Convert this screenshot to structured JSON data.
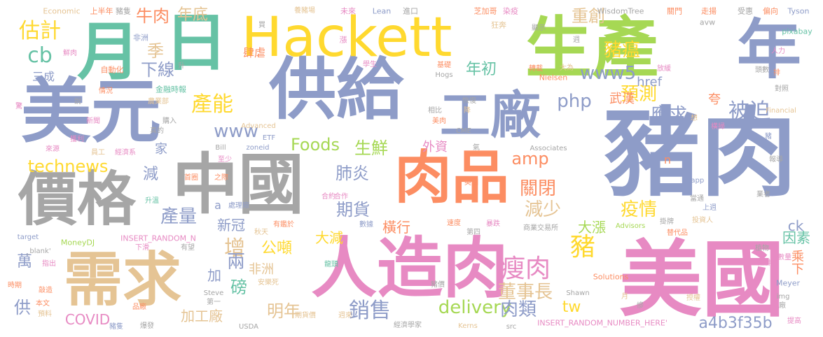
{
  "palette": {
    "slate": "#8E9CC8",
    "grey": "#A6A6A6",
    "green": "#66C2A5",
    "orange": "#FC8D62",
    "pink": "#E78AC3",
    "lime": "#A6D854",
    "yellow": "#FFD92F",
    "tan": "#E5C494"
  },
  "words": [
    {
      "id": "zhu-rou",
      "text": "豬肉",
      "color": "slate"
    },
    {
      "id": "mei-guo",
      "text": "美國",
      "color": "pink"
    },
    {
      "id": "sheng-chan",
      "text": "生產",
      "color": "lime"
    },
    {
      "id": "gong-ji",
      "text": "供給",
      "color": "slate"
    },
    {
      "id": "mei-yuan",
      "text": "美元",
      "color": "slate"
    },
    {
      "id": "hackett",
      "text": "Hackett",
      "color": "yellow"
    },
    {
      "id": "zhong-guo",
      "text": "中國",
      "color": "grey"
    },
    {
      "id": "ren-zao-rou",
      "text": "人造肉",
      "color": "pink"
    },
    {
      "id": "xu-qiu",
      "text": "需求",
      "color": "tan"
    },
    {
      "id": "rou-pin",
      "text": "肉品",
      "color": "orange"
    },
    {
      "id": "jia-ge",
      "text": "價格",
      "color": "grey"
    },
    {
      "id": "gong-chang",
      "text": "工廠",
      "color": "slate"
    },
    {
      "id": "nian",
      "text": "年",
      "color": "slate"
    },
    {
      "id": "yue",
      "text": "月",
      "color": "green"
    },
    {
      "id": "ri",
      "text": "日",
      "color": "green"
    },
    {
      "id": "shou-rou",
      "text": "瘦肉",
      "color": "pink"
    },
    {
      "id": "zhu",
      "text": "豬",
      "color": "yellow"
    },
    {
      "id": "foods",
      "text": "Foods",
      "color": "lime"
    },
    {
      "id": "chan-neng",
      "text": "產能",
      "color": "yellow"
    },
    {
      "id": "www5",
      "text": "www5",
      "color": "slate"
    },
    {
      "id": "www",
      "text": "www",
      "color": "slate"
    },
    {
      "id": "technews",
      "text": "technews",
      "color": "yellow"
    },
    {
      "id": "delivery",
      "text": "delivery",
      "color": "lime"
    },
    {
      "id": "php",
      "text": "php",
      "color": "slate"
    },
    {
      "id": "xiao-shou",
      "text": "銷售",
      "color": "slate"
    },
    {
      "id": "dong-shi-zhang",
      "text": "董事長",
      "color": "tan"
    },
    {
      "id": "rou-lei",
      "text": "肉類",
      "color": "slate"
    },
    {
      "id": "qi-huo",
      "text": "期貨",
      "color": "slate"
    },
    {
      "id": "jian-shao",
      "text": "減少",
      "color": "tan"
    },
    {
      "id": "guan-bi",
      "text": "關閉",
      "color": "orange"
    },
    {
      "id": "yi-qing",
      "text": "疫情",
      "color": "yellow"
    },
    {
      "id": "yu-ce",
      "text": "預測",
      "color": "yellow"
    },
    {
      "id": "ying-qiu",
      "text": "應求",
      "color": "slate"
    },
    {
      "id": "bei-po",
      "text": "被迫",
      "color": "slate"
    },
    {
      "id": "zhu-wen",
      "text": "豬瘟",
      "color": "yellow"
    },
    {
      "id": "zhong-chuang",
      "text": "重創",
      "color": "tan"
    },
    {
      "id": "nian-di",
      "text": "年底",
      "color": "tan"
    },
    {
      "id": "niu-rou",
      "text": "牛肉",
      "color": "orange"
    },
    {
      "id": "gu-ji",
      "text": "估計",
      "color": "yellow"
    },
    {
      "id": "cb",
      "text": "cb",
      "color": "green"
    },
    {
      "id": "ji",
      "text": "季",
      "color": "tan"
    },
    {
      "id": "xia-xian",
      "text": "下線",
      "color": "slate"
    },
    {
      "id": "nian-chu",
      "text": "年初",
      "color": "green"
    },
    {
      "id": "sheng-xian",
      "text": "生鮮",
      "color": "lime"
    },
    {
      "id": "fei-yan",
      "text": "肺炎",
      "color": "slate"
    },
    {
      "id": "amp",
      "text": "amp",
      "color": "orange"
    },
    {
      "id": "chan-liang",
      "text": "產量",
      "color": "slate"
    },
    {
      "id": "xin-guan",
      "text": "新冠",
      "color": "slate"
    },
    {
      "id": "zeng",
      "text": "增",
      "color": "tan"
    },
    {
      "id": "gong-dun",
      "text": "公噸",
      "color": "yellow"
    },
    {
      "id": "da-jian",
      "text": "大減",
      "color": "yellow"
    },
    {
      "id": "heng-xing",
      "text": "橫行",
      "color": "orange"
    },
    {
      "id": "da-zhang",
      "text": "大漲",
      "color": "lime"
    },
    {
      "id": "a4b3f35b",
      "text": "a4b3f35b",
      "color": "slate"
    },
    {
      "id": "yin-su",
      "text": "因素",
      "color": "green"
    },
    {
      "id": "ming-nian",
      "text": "明年",
      "color": "tan"
    },
    {
      "id": "jia-gong-chang",
      "text": "加工廠",
      "color": "tan"
    },
    {
      "id": "covid",
      "text": "COVID",
      "color": "pink"
    },
    {
      "id": "tw",
      "text": "tw",
      "color": "yellow"
    },
    {
      "id": "ck",
      "text": "ck",
      "color": "slate"
    },
    {
      "id": "gong",
      "text": "供",
      "color": "slate"
    },
    {
      "id": "bang",
      "text": "磅",
      "color": "green"
    },
    {
      "id": "liang",
      "text": "兩",
      "color": "slate"
    },
    {
      "id": "jia",
      "text": "加",
      "color": "slate"
    },
    {
      "id": "fei-zhou",
      "text": "非洲",
      "color": "tan"
    },
    {
      "id": "wan",
      "text": "萬",
      "color": "slate"
    },
    {
      "id": "jian",
      "text": "減",
      "color": "slate"
    },
    {
      "id": "jia-home",
      "text": "家",
      "color": "slate"
    },
    {
      "id": "wu-han",
      "text": "武漢",
      "color": "orange"
    },
    {
      "id": "href",
      "text": "href",
      "color": "slate"
    },
    {
      "id": "si-nue",
      "text": "肆虐",
      "color": "orange"
    },
    {
      "id": "wai-zi",
      "text": "外資",
      "color": "pink"
    },
    {
      "id": "kua",
      "text": "夸",
      "color": "orange"
    },
    {
      "id": "cheng-xia",
      "text": "乘下",
      "color": "orange"
    },
    {
      "id": "san-cheng",
      "text": "三成",
      "color": "slate"
    },
    {
      "id": "n",
      "text": "n",
      "color": "orange"
    },
    {
      "id": "a",
      "text": "a",
      "color": "slate"
    },
    {
      "id": "insert-random",
      "text": "INSERT_RANDOM_NUMBER_HERE'",
      "color": "pink"
    },
    {
      "id": "insert-random-n",
      "text": "INSERT_RANDOM_N",
      "color": "pink"
    },
    {
      "id": "economic",
      "text": "Economic",
      "color": "tan"
    },
    {
      "id": "shang-ban-nian",
      "text": "上半年",
      "color": "orange"
    },
    {
      "id": "zhu-jian",
      "text": "豬隻",
      "color": "grey"
    },
    {
      "id": "yang-zhu-chang",
      "text": "養豬場",
      "color": "tan"
    },
    {
      "id": "wei-lai",
      "text": "未來",
      "color": "pink"
    },
    {
      "id": "lean",
      "text": "Lean",
      "color": "slate"
    },
    {
      "id": "jin-kou",
      "text": "進口",
      "color": "grey"
    },
    {
      "id": "zhi-jia-ge",
      "text": "芝加哥",
      "color": "orange"
    },
    {
      "id": "ran-yi",
      "text": "染疫",
      "color": "pink"
    },
    {
      "id": "wisdomtree",
      "text": "WisdomTree",
      "color": "grey"
    },
    {
      "id": "guan-men",
      "text": "關門",
      "color": "orange"
    },
    {
      "id": "zou-yang",
      "text": "走揚",
      "color": "orange"
    },
    {
      "id": "shou-hui",
      "text": "受惠",
      "color": "grey"
    },
    {
      "id": "pian-xiang",
      "text": "偏向",
      "color": "orange"
    },
    {
      "id": "tyson",
      "text": "Tyson",
      "color": "slate"
    },
    {
      "id": "fei-zhou-2",
      "text": "非洲",
      "color": "slate"
    },
    {
      "id": "mai",
      "text": "買",
      "color": "grey"
    },
    {
      "id": "zhang",
      "text": "漲",
      "color": "pink"
    },
    {
      "id": "kuang-ben",
      "text": "狂奔",
      "color": "tan"
    },
    {
      "id": "xian-shi",
      "text": "顯示",
      "color": "grey"
    },
    {
      "id": "avw",
      "text": "avw",
      "color": "grey"
    },
    {
      "id": "pixabay",
      "text": "pixabay",
      "color": "green"
    },
    {
      "id": "xian-rou",
      "text": "鮮肉",
      "color": "pink"
    },
    {
      "id": "sheng",
      "text": "升",
      "color": "grey"
    },
    {
      "id": "xue-sheng",
      "text": "學生",
      "color": "pink"
    },
    {
      "id": "zhou",
      "text": "週",
      "color": "grey"
    },
    {
      "id": "ren-li",
      "text": "人力",
      "color": "pink"
    },
    {
      "id": "zi-dong-hua",
      "text": "自動化",
      "color": "orange"
    },
    {
      "id": "ji-chu",
      "text": "基礎",
      "color": "orange"
    },
    {
      "id": "zhuan-zai",
      "text": "轉載",
      "color": "orange"
    },
    {
      "id": "da-wei",
      "text": "大為",
      "color": "tan"
    },
    {
      "id": "fang-huan",
      "text": "放緩",
      "color": "pink"
    },
    {
      "id": "pai",
      "text": "排",
      "color": "orange"
    },
    {
      "id": "jin-rong-shi-bao",
      "text": "金融時報",
      "color": "green"
    },
    {
      "id": "hogs",
      "text": "Hogs",
      "color": "grey"
    },
    {
      "id": "nielsen",
      "text": "Nielsen",
      "color": "orange"
    },
    {
      "id": "pin-shu",
      "text": "頭數",
      "color": "grey"
    },
    {
      "id": "dui-zhao",
      "text": "對照",
      "color": "grey"
    },
    {
      "id": "shuo",
      "text": "說",
      "color": "grey"
    },
    {
      "id": "qing-kuang",
      "text": "情況",
      "color": "orange"
    },
    {
      "id": "nong-ye-bu",
      "text": "農業部",
      "color": "tan"
    },
    {
      "id": "hui-fu",
      "text": "恢復",
      "color": "grey"
    },
    {
      "id": "jing",
      "text": "驚",
      "color": "pink"
    },
    {
      "id": "xiang-bi",
      "text": "相比",
      "color": "grey"
    },
    {
      "id": "jiang",
      "text": "降",
      "color": "tan"
    },
    {
      "id": "financial",
      "text": "Financial",
      "color": "tan"
    },
    {
      "id": "xin-wen",
      "text": "新聞",
      "color": "pink"
    },
    {
      "id": "gou-ru",
      "text": "購入",
      "color": "grey"
    },
    {
      "id": "zhen-de",
      "text": "真的",
      "color": "grey"
    },
    {
      "id": "advanced",
      "text": "Advanced",
      "color": "tan"
    },
    {
      "id": "mei-rou",
      "text": "美肉",
      "color": "orange"
    },
    {
      "id": "xiang",
      "text": "想",
      "color": "tan"
    },
    {
      "id": "huo-li",
      "text": "獲利",
      "color": "pink"
    },
    {
      "id": "etf",
      "text": "ETF",
      "color": "slate"
    },
    {
      "id": "bill",
      "text": "Bill",
      "color": "grey"
    },
    {
      "id": "zoneid",
      "text": "zoneid",
      "color": "slate"
    },
    {
      "id": "cme",
      "text": "CME",
      "color": "grey"
    },
    {
      "id": "qi",
      "text": "氣",
      "color": "grey"
    },
    {
      "id": "heng-sao",
      "text": "橫掃",
      "color": "pink"
    },
    {
      "id": "lai-yuan",
      "text": "來源",
      "color": "pink"
    },
    {
      "id": "yuan-gong",
      "text": "員工",
      "color": "tan"
    },
    {
      "id": "jing-ji-xi",
      "text": "經濟系",
      "color": "pink"
    },
    {
      "id": "associates",
      "text": "Associates",
      "color": "grey"
    },
    {
      "id": "zhu-2",
      "text": "豬",
      "color": "slate"
    },
    {
      "id": "bao-dao",
      "text": "報導",
      "color": "grey"
    },
    {
      "id": "zhi-shao",
      "text": "至少",
      "color": "pink"
    },
    {
      "id": "shou-ye",
      "text": "首圈",
      "color": "orange"
    },
    {
      "id": "zhi-ji",
      "text": "之際",
      "color": "orange"
    },
    {
      "id": "ying-guo",
      "text": "英國",
      "color": "orange"
    },
    {
      "id": "he-zuo",
      "text": "合作",
      "color": "pink"
    },
    {
      "id": "lapp",
      "text": "Lapp",
      "color": "slate"
    },
    {
      "id": "ye-zhe",
      "text": "業者",
      "color": "grey"
    },
    {
      "id": "sheng-wen",
      "text": "升溫",
      "color": "green"
    },
    {
      "id": "chu-li-zhong",
      "text": "處理廠",
      "color": "slate"
    },
    {
      "id": "he-yue",
      "text": "合約",
      "color": "pink"
    },
    {
      "id": "dang-tong",
      "text": "當通",
      "color": "grey"
    },
    {
      "id": "shang-zhou",
      "text": "上週",
      "color": "slate"
    },
    {
      "id": "shu-ju",
      "text": "數據",
      "color": "slate"
    },
    {
      "id": "su-du",
      "text": "速度",
      "color": "orange"
    },
    {
      "id": "bao-die",
      "text": "暴跌",
      "color": "pink"
    },
    {
      "id": "tou-zi-ren",
      "text": "投資人",
      "color": "tan"
    },
    {
      "id": "yin-yin",
      "text": "有鑑於",
      "color": "orange"
    },
    {
      "id": "qiu-ji",
      "text": "秋天",
      "color": "tan"
    },
    {
      "id": "di-si",
      "text": "第四",
      "color": "grey"
    },
    {
      "id": "shang-pin",
      "text": "商業交易所",
      "color": "grey"
    },
    {
      "id": "advisors",
      "text": "Advisors",
      "color": "lime"
    },
    {
      "id": "gua-pai",
      "text": "掛牌",
      "color": "grey"
    },
    {
      "id": "ti-dai-pin",
      "text": "替代品",
      "color": "orange"
    },
    {
      "id": "target",
      "text": "target",
      "color": "slate"
    },
    {
      "id": "moneydj",
      "text": "MoneyDJ",
      "color": "lime"
    },
    {
      "id": "blank",
      "text": "_blank'",
      "color": "grey"
    },
    {
      "id": "zhi-wu",
      "text": "植物",
      "color": "grey"
    },
    {
      "id": "shu-liang",
      "text": "數量",
      "color": "pink"
    },
    {
      "id": "xia-hua",
      "text": "下滑",
      "color": "pink"
    },
    {
      "id": "you-wang",
      "text": "有望",
      "color": "grey"
    },
    {
      "id": "zhi-chu",
      "text": "指出",
      "color": "pink"
    },
    {
      "id": "long-tou",
      "text": "龍頭",
      "color": "green"
    },
    {
      "id": "an-le-si",
      "text": "安樂死",
      "color": "tan"
    },
    {
      "id": "yan-shen",
      "text": "延伸",
      "color": "pink"
    },
    {
      "id": "meyer",
      "text": "Meyer",
      "color": "slate"
    },
    {
      "id": "solutions",
      "text": "Solutions",
      "color": "orange"
    },
    {
      "id": "shi-qi",
      "text": "時期",
      "color": "orange"
    },
    {
      "id": "qiao-ke",
      "text": "敲造",
      "color": "orange"
    },
    {
      "id": "ben-wen",
      "text": "本文",
      "color": "orange"
    },
    {
      "id": "yu-ji",
      "text": "預料",
      "color": "tan"
    },
    {
      "id": "steve",
      "text": "Steve",
      "color": "grey"
    },
    {
      "id": "di-yi",
      "text": "第一",
      "color": "grey"
    },
    {
      "id": "zhu-jia",
      "text": "豬價",
      "color": "grey"
    },
    {
      "id": "shawn",
      "text": "Shawn",
      "color": "grey"
    },
    {
      "id": "shou-quan",
      "text": "授權",
      "color": "tan"
    },
    {
      "id": "yue-2",
      "text": "月",
      "color": "tan"
    },
    {
      "id": "can",
      "text": "慘",
      "color": "grey"
    },
    {
      "id": "img",
      "text": "img",
      "color": "grey"
    },
    {
      "id": "chang",
      "text": "廠",
      "color": "grey"
    },
    {
      "id": "pin-kuan",
      "text": "品廠",
      "color": "orange"
    },
    {
      "id": "qi-huo-jia",
      "text": "期貨價",
      "color": "tan"
    },
    {
      "id": "zhou-lai",
      "text": "週來",
      "color": "tan"
    },
    {
      "id": "zhu-jian-2",
      "text": "豬隻",
      "color": "slate"
    },
    {
      "id": "bao-fa",
      "text": "爆發",
      "color": "grey"
    },
    {
      "id": "usda",
      "text": "USDA",
      "color": "grey"
    },
    {
      "id": "jing-ji-xue-jia",
      "text": "經濟學家",
      "color": "grey"
    },
    {
      "id": "kerns",
      "text": "Kerns",
      "color": "tan"
    },
    {
      "id": "src",
      "text": "src",
      "color": "grey"
    },
    {
      "id": "ti-gao",
      "text": "提高",
      "color": "pink"
    }
  ]
}
